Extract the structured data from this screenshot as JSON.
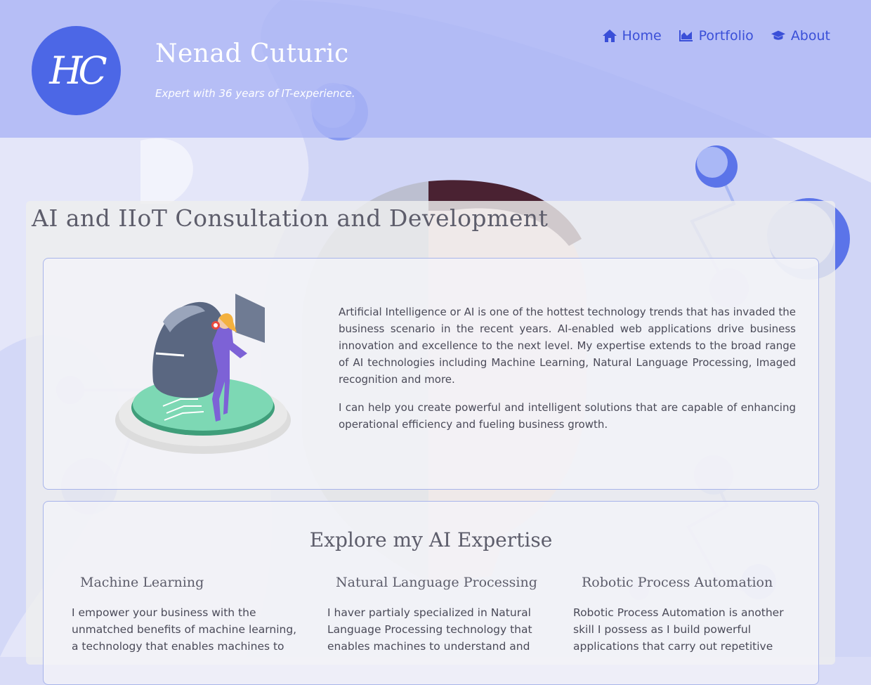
{
  "header": {
    "logo_text": "HC",
    "site_title": "Nenad Cuturic",
    "tagline": "Expert with 36 years of IT-experience."
  },
  "nav": {
    "items": [
      {
        "label": "Home",
        "icon": "home-icon"
      },
      {
        "label": "Portfolio",
        "icon": "chart-area-icon"
      },
      {
        "label": "About",
        "icon": "graduation-cap-icon"
      }
    ]
  },
  "main": {
    "title": "AI and IIoT Consultation and Development",
    "intro": {
      "paragraphs": [
        "Artificial Intelligence or AI is one of the hottest technology trends that has invaded the business scenario in the recent years. AI-enabled web applications drive business innovation and excellence to the next level. My expertise extends to the broad range of AI technologies including Machine Learning, Natural Language Processing, Imaged recognition and more.",
        "I can help you create powerful and intelligent solutions that are capable of enhancing operational efficiency and fueling business growth."
      ]
    },
    "expertise": {
      "title": "Explore my AI Expertise",
      "columns": [
        {
          "heading": "Machine Learning",
          "text": "I empower your business with the unmatched benefits of machine learning, a technology that enables machines to"
        },
        {
          "heading": "Natural Language Processing",
          "text": "I haver partialy specialized in Natural Language Processing technology that enables machines to understand and"
        },
        {
          "heading": "Robotic Process Automation",
          "text": "Robotic Process Automation is another skill I possess as I build powerful applications that carry out repetitive"
        }
      ]
    }
  },
  "colors": {
    "accent": "#4c67e6",
    "nav_link": "#3a4fd8",
    "header_bg": "#aab4f5",
    "card_border": "#a8b4ea"
  }
}
